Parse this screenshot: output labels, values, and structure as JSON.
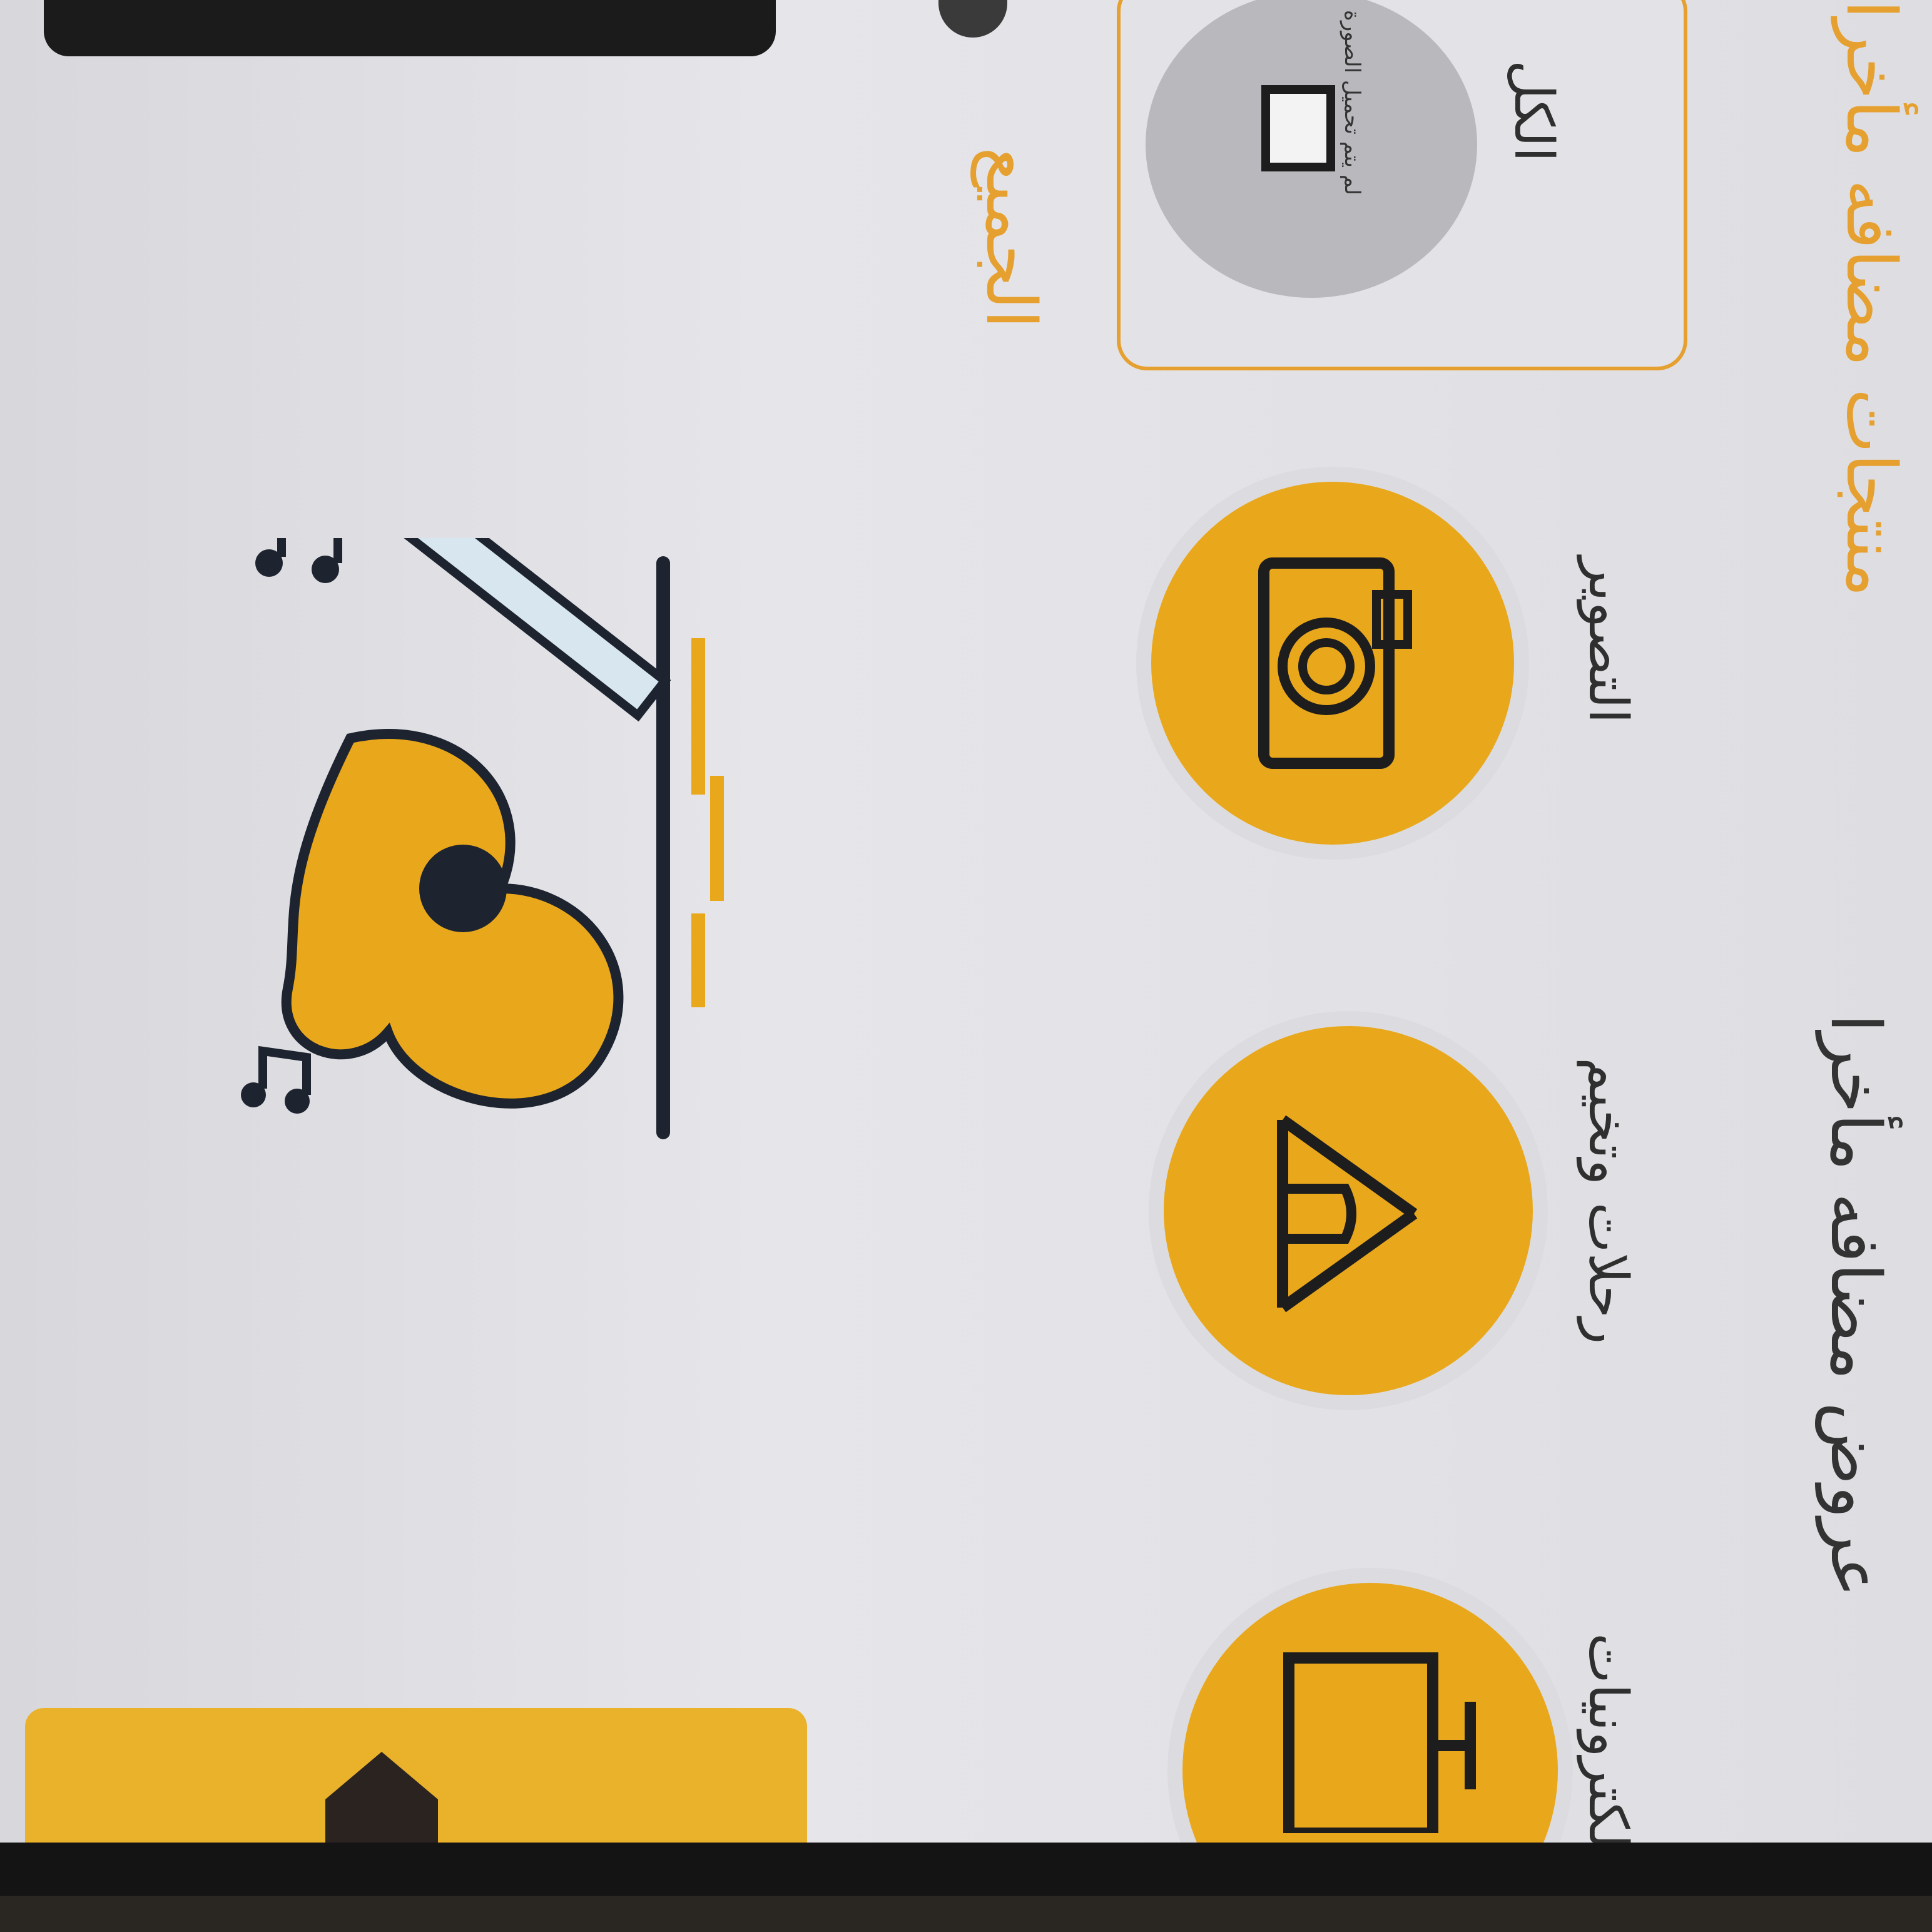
{
  "section": {
    "all_link": "الجميع",
    "offers_title": "عروض مضافه مأخرا",
    "products_title": "منتجات مضافه مأخرا"
  },
  "categories": [
    {
      "label": "التصوير",
      "icon": "camera-icon"
    },
    {
      "label": "رحلات وتخيم",
      "icon": "tent-icon"
    },
    {
      "label": "الكترونيات",
      "icon": "tv-icon"
    }
  ],
  "filter": {
    "all_label": "الكل",
    "image_not_loaded": "لم يتم تحميل الصورة"
  },
  "colors": {
    "accent": "#e9a71c",
    "accent_text": "#e5a030"
  }
}
